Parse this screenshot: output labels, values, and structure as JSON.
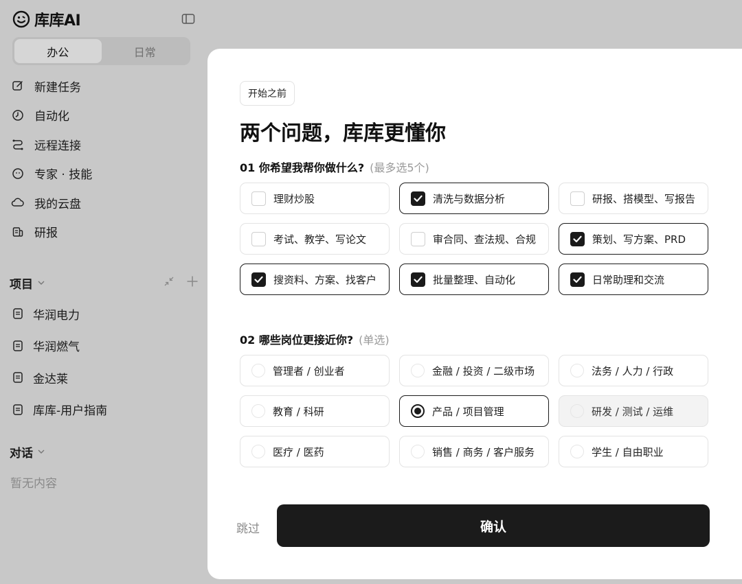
{
  "sidebar": {
    "brand_name": "库库AI",
    "mode_tabs": [
      {
        "label": "办公",
        "active": true
      },
      {
        "label": "日常",
        "active": false
      }
    ],
    "nav_items": [
      {
        "label": "新建任务",
        "icon": "edit-icon"
      },
      {
        "label": "自动化",
        "icon": "clock-icon"
      },
      {
        "label": "远程连接",
        "icon": "route-icon"
      },
      {
        "label": "专家 · 技能",
        "icon": "smile-icon"
      },
      {
        "label": "我的云盘",
        "icon": "cloud-icon"
      },
      {
        "label": "研报",
        "icon": "report-icon"
      }
    ],
    "projects_label": "项目",
    "projects": [
      {
        "label": "华润电力"
      },
      {
        "label": "华润燃气"
      },
      {
        "label": "金达莱"
      },
      {
        "label": "库库-用户指南"
      }
    ],
    "chats_label": "对话",
    "chats_empty": "暂无内容"
  },
  "modal": {
    "pill": "开始之前",
    "title": "两个问题，库库更懂你",
    "q1": {
      "title": "01 你希望我帮你做什么?",
      "hint": "(最多选5个)",
      "options": [
        {
          "label": "理财炒股",
          "checked": false
        },
        {
          "label": "清洗与数据分析",
          "checked": true
        },
        {
          "label": "研报、搭模型、写报告",
          "checked": false
        },
        {
          "label": "考试、教学、写论文",
          "checked": false
        },
        {
          "label": "审合同、查法规、合规",
          "checked": false
        },
        {
          "label": "策划、写方案、PRD",
          "checked": true
        },
        {
          "label": "搜资料、方案、找客户",
          "checked": true
        },
        {
          "label": "批量整理、自动化",
          "checked": true
        },
        {
          "label": "日常助理和交流",
          "checked": true
        }
      ]
    },
    "q2": {
      "title": "02 哪些岗位更接近你?",
      "hint": "(单选)",
      "options": [
        {
          "label": "管理者 / 创业者",
          "selected": false
        },
        {
          "label": "金融 / 投资 / 二级市场",
          "selected": false
        },
        {
          "label": "法务 / 人力 / 行政",
          "selected": false
        },
        {
          "label": "教育 / 科研",
          "selected": false
        },
        {
          "label": "产品 / 项目管理",
          "selected": true
        },
        {
          "label": "研发 / 测试 / 运维",
          "selected": false
        },
        {
          "label": "医疗 / 医药",
          "selected": false
        },
        {
          "label": "销售 / 商务 / 客户服务",
          "selected": false
        },
        {
          "label": "学生 / 自由职业",
          "selected": false
        }
      ]
    },
    "skip_label": "跳过",
    "confirm_label": "确认"
  }
}
